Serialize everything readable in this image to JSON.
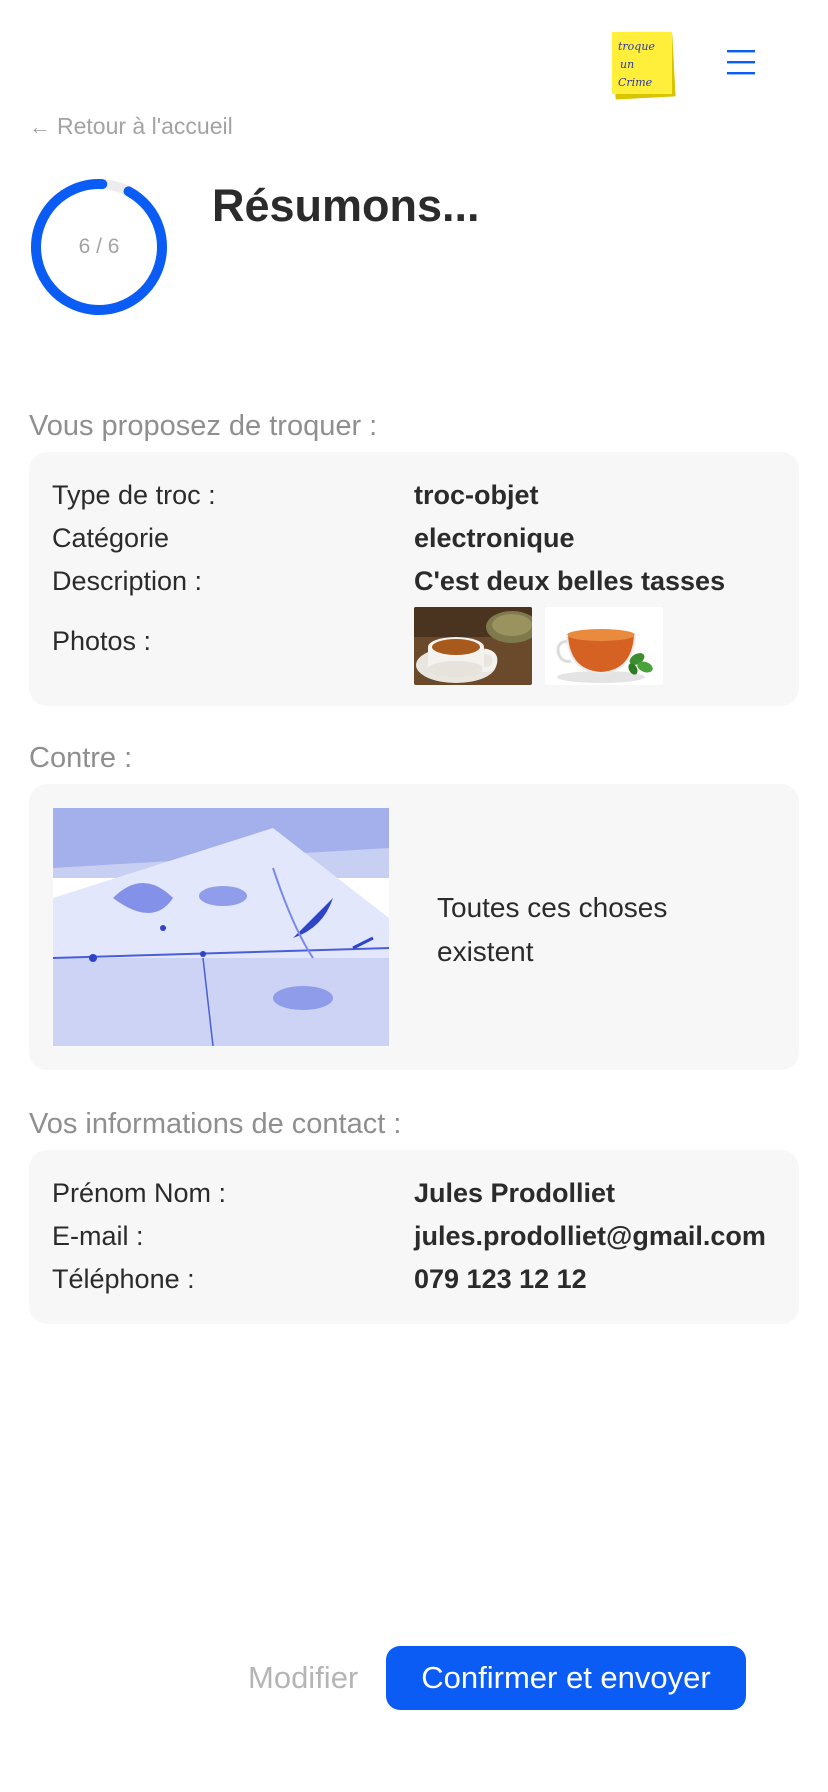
{
  "header": {
    "logo_text_lines": [
      "troque",
      "un",
      "Crime"
    ],
    "menu_icon": "hamburger-menu-icon"
  },
  "nav": {
    "back_arrow": "←",
    "back_label": "Retour à l'accueil"
  },
  "progress": {
    "label": "6 / 6",
    "current": 6,
    "total": 6,
    "fraction": 1.0
  },
  "page_title": "Résumons...",
  "offer": {
    "heading": "Vous proposez de troquer :",
    "rows": [
      {
        "label": "Type de troc :",
        "value": "troc-objet"
      },
      {
        "label": "Catégorie",
        "value": "electronique"
      },
      {
        "label": "Description :",
        "value": "C'est deux belles tasses"
      }
    ],
    "photos_label": "Photos :",
    "photos": [
      "tea-cup-with-herbs-photo",
      "tea-cup-with-mint-photo"
    ]
  },
  "against": {
    "heading": "Contre :",
    "image": "blue-sketch-still-life-image",
    "text": "Toutes ces choses existent"
  },
  "contact": {
    "heading": "Vos informations de contact :",
    "rows": [
      {
        "label": "Prénom Nom :",
        "value": "Jules Prodolliet"
      },
      {
        "label": "E-mail :",
        "value": "jules.prodolliet@gmail.com"
      },
      {
        "label": "Téléphone :",
        "value": "079 123 12 12"
      }
    ]
  },
  "actions": {
    "modify_label": "Modifier",
    "confirm_label": "Confirmer et envoyer"
  },
  "colors": {
    "accent": "#0a5cf5",
    "muted_text": "#8f8f8f",
    "card_bg": "#f7f7f7",
    "logo_yellow": "#ffee3a"
  }
}
